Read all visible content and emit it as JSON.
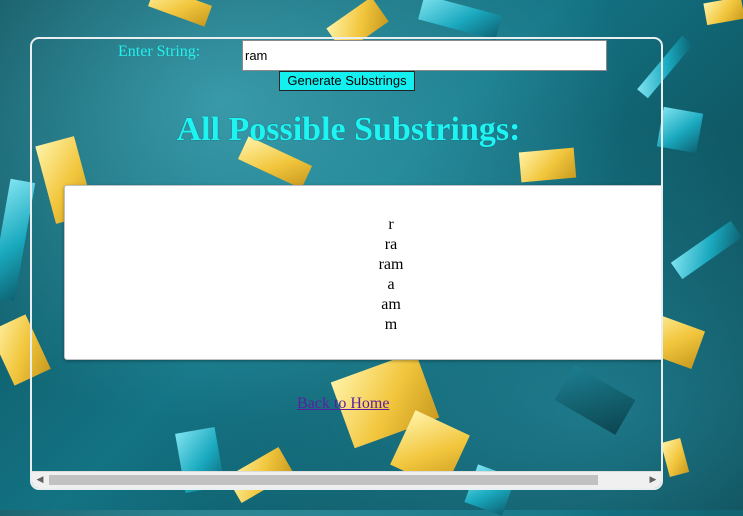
{
  "form": {
    "label": "Enter String:",
    "input_value": "ram",
    "button_label": "Generate Substrings"
  },
  "heading": "All Possible Substrings:",
  "substrings": [
    "r",
    "ra",
    "ram",
    "a",
    "am",
    "m"
  ],
  "back_link": "Back to Home",
  "colors": {
    "accent": "#1ef5f3",
    "button_bg": "#14f0f0",
    "link": "#5a1fa0"
  }
}
